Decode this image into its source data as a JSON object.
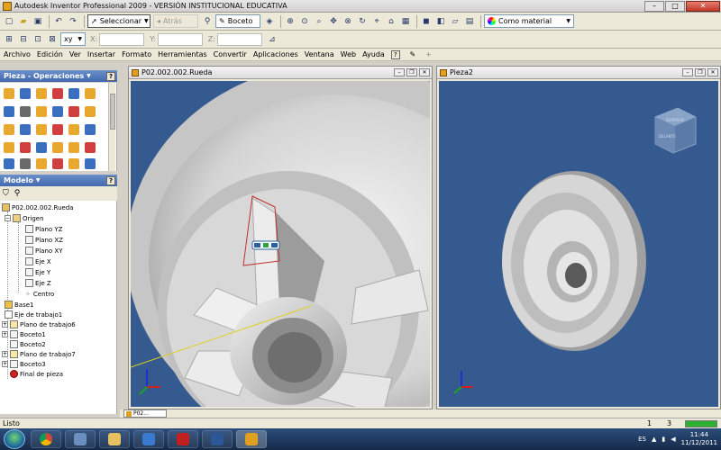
{
  "window": {
    "title": "Autodesk Inventor Professional 2009 - VERSIÓN INSTITUCIONAL EDUCATIVA",
    "min": "–",
    "max": "□",
    "close": "✕"
  },
  "toolbar": {
    "select_label": "Seleccionar",
    "back_label": "Atrás",
    "sketch_label": "Boceto",
    "material_label": "Como material",
    "coord_xy": "xy",
    "coord_x": "X:",
    "coord_y": "Y:",
    "coord_z": "Z:"
  },
  "menu": [
    "Archivo",
    "Edición",
    "Ver",
    "Insertar",
    "Formato",
    "Herramientas",
    "Convertir",
    "Aplicaciones",
    "Ventana",
    "Web",
    "Ayuda"
  ],
  "panels": {
    "ops_title": "Pieza - Operaciones",
    "model_title": "Modelo",
    "help": "?"
  },
  "tree": {
    "root": "P02.002.002.Rueda",
    "origin": "Origen",
    "plane_yz": "Plano YZ",
    "plane_xz": "Plano XZ",
    "plane_xy": "Plano XY",
    "axis_x": "Eje X",
    "axis_y": "Eje Y",
    "axis_z": "Eje Z",
    "center": "Centro",
    "base1": "Base1",
    "work_axis1": "Eje de trabajo1",
    "work_plane6": "Plano de trabajo6",
    "sketch1": "Boceto1",
    "sketch2": "Boceto2",
    "work_plane7": "Plano de trabajo7",
    "sketch3": "Boceto3",
    "end": "Final de pieza"
  },
  "docs": {
    "left_title": "P02.002.002.Rueda",
    "right_title": "Pieza2",
    "tab_label": "P02..."
  },
  "viewcube": {
    "top": "SUPERIOR",
    "front": "DELANTE"
  },
  "status": {
    "text": "Listo",
    "count1": "1",
    "count2": "3"
  },
  "tray": {
    "lang": "ES",
    "time": "11:44",
    "date": "11/12/2011"
  },
  "colors": {
    "viewport_bg": "#355a8f",
    "panel_header": "#4269b0",
    "taskbar": "#1d3659"
  }
}
